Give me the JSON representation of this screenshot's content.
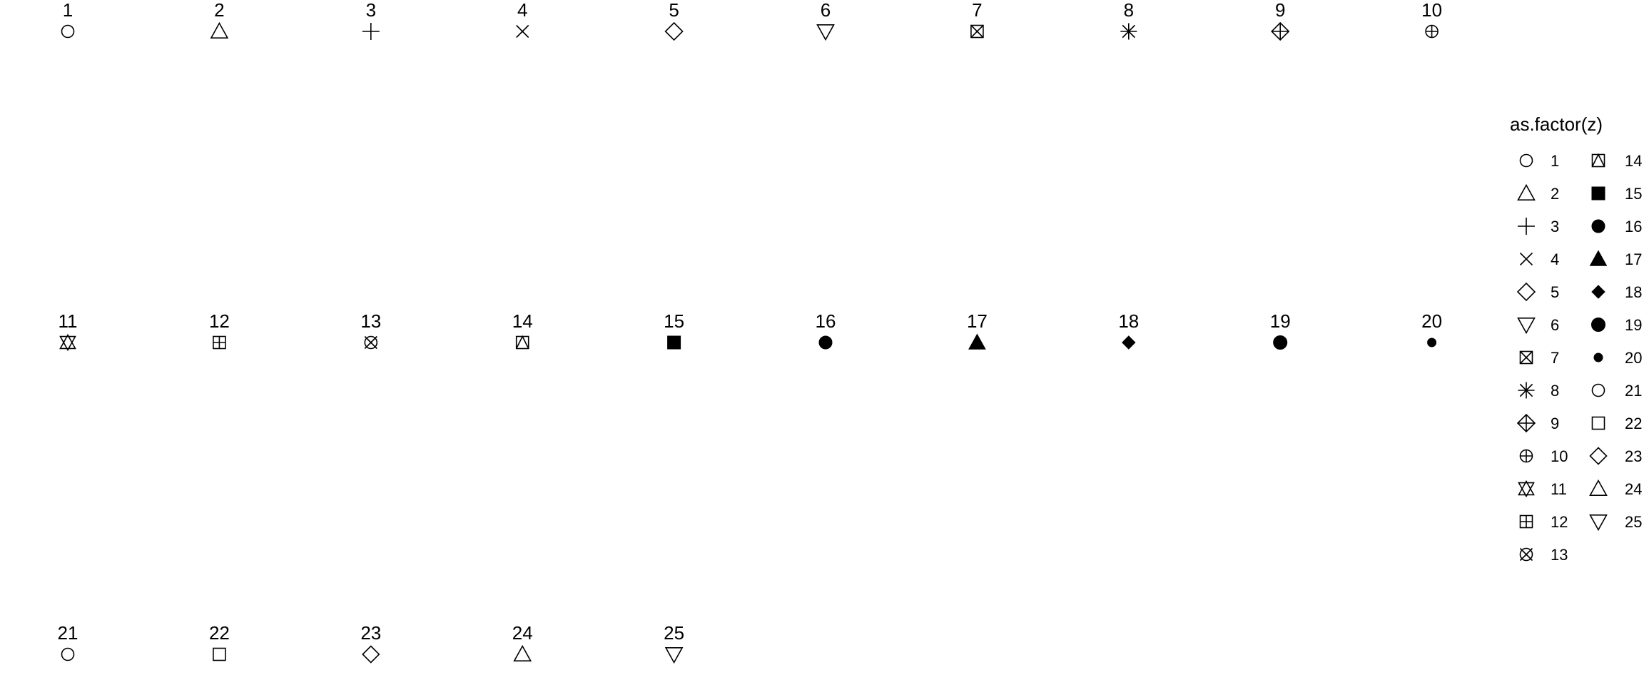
{
  "chart_data": {
    "type": "scatter",
    "title": "",
    "xlabel": "",
    "ylabel": "",
    "grid": false,
    "legend_position": "right",
    "legend_title": "as.factor(z)",
    "x_range": [
      0.6,
      10.4
    ],
    "y_range": [
      0.6,
      3.4
    ],
    "points": [
      {
        "x": 1,
        "y": 3,
        "z": 1,
        "label": "1",
        "shape": 1
      },
      {
        "x": 2,
        "y": 3,
        "z": 2,
        "label": "2",
        "shape": 2
      },
      {
        "x": 3,
        "y": 3,
        "z": 3,
        "label": "3",
        "shape": 3
      },
      {
        "x": 4,
        "y": 3,
        "z": 4,
        "label": "4",
        "shape": 4
      },
      {
        "x": 5,
        "y": 3,
        "z": 5,
        "label": "5",
        "shape": 5
      },
      {
        "x": 6,
        "y": 3,
        "z": 6,
        "label": "6",
        "shape": 6
      },
      {
        "x": 7,
        "y": 3,
        "z": 7,
        "label": "7",
        "shape": 7
      },
      {
        "x": 8,
        "y": 3,
        "z": 8,
        "label": "8",
        "shape": 8
      },
      {
        "x": 9,
        "y": 3,
        "z": 9,
        "label": "9",
        "shape": 9
      },
      {
        "x": 10,
        "y": 3,
        "z": 10,
        "label": "10",
        "shape": 10
      },
      {
        "x": 1,
        "y": 2,
        "z": 11,
        "label": "11",
        "shape": 11
      },
      {
        "x": 2,
        "y": 2,
        "z": 12,
        "label": "12",
        "shape": 12
      },
      {
        "x": 3,
        "y": 2,
        "z": 13,
        "label": "13",
        "shape": 13
      },
      {
        "x": 4,
        "y": 2,
        "z": 14,
        "label": "14",
        "shape": 14
      },
      {
        "x": 5,
        "y": 2,
        "z": 15,
        "label": "15",
        "shape": 15
      },
      {
        "x": 6,
        "y": 2,
        "z": 16,
        "label": "16",
        "shape": 16
      },
      {
        "x": 7,
        "y": 2,
        "z": 17,
        "label": "17",
        "shape": 17
      },
      {
        "x": 8,
        "y": 2,
        "z": 18,
        "label": "18",
        "shape": 18
      },
      {
        "x": 9,
        "y": 2,
        "z": 19,
        "label": "19",
        "shape": 19
      },
      {
        "x": 10,
        "y": 2,
        "z": 20,
        "label": "20",
        "shape": 20
      },
      {
        "x": 1,
        "y": 1,
        "z": 21,
        "label": "21",
        "shape": 21
      },
      {
        "x": 2,
        "y": 1,
        "z": 22,
        "label": "22",
        "shape": 22
      },
      {
        "x": 3,
        "y": 1,
        "z": 23,
        "label": "23",
        "shape": 23
      },
      {
        "x": 4,
        "y": 1,
        "z": 24,
        "label": "24",
        "shape": 24
      },
      {
        "x": 5,
        "y": 1,
        "z": 25,
        "label": "25",
        "shape": 25
      }
    ],
    "legend_entries": [
      {
        "label": "1",
        "shape": 1
      },
      {
        "label": "2",
        "shape": 2
      },
      {
        "label": "3",
        "shape": 3
      },
      {
        "label": "4",
        "shape": 4
      },
      {
        "label": "5",
        "shape": 5
      },
      {
        "label": "6",
        "shape": 6
      },
      {
        "label": "7",
        "shape": 7
      },
      {
        "label": "8",
        "shape": 8
      },
      {
        "label": "9",
        "shape": 9
      },
      {
        "label": "10",
        "shape": 10
      },
      {
        "label": "11",
        "shape": 11
      },
      {
        "label": "12",
        "shape": 12
      },
      {
        "label": "13",
        "shape": 13
      },
      {
        "label": "14",
        "shape": 14
      },
      {
        "label": "15",
        "shape": 15
      },
      {
        "label": "16",
        "shape": 16
      },
      {
        "label": "17",
        "shape": 17
      },
      {
        "label": "18",
        "shape": 18
      },
      {
        "label": "19",
        "shape": 19
      },
      {
        "label": "20",
        "shape": 20
      },
      {
        "label": "21",
        "shape": 21
      },
      {
        "label": "22",
        "shape": 22
      },
      {
        "label": "23",
        "shape": 23
      },
      {
        "label": "24",
        "shape": 24
      },
      {
        "label": "25",
        "shape": 25
      }
    ]
  }
}
